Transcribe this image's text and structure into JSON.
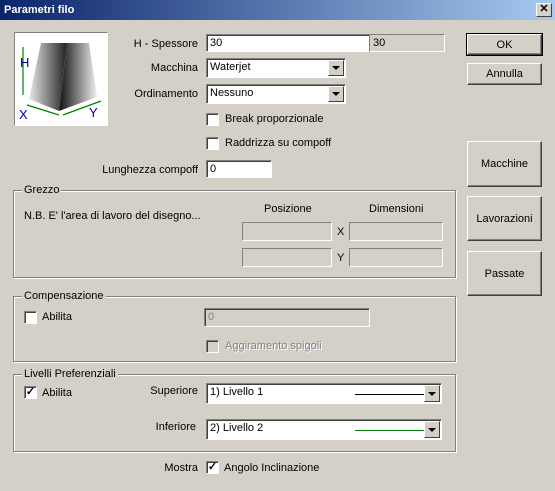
{
  "window": {
    "title": "Parametri filo",
    "close_glyph": "✕"
  },
  "icon": {
    "name": "wire-thickness-icon",
    "h_label": "H",
    "x_label": "X",
    "y_label": "Y"
  },
  "spessore": {
    "label": "H - Spessore",
    "value": "30",
    "readout": "30"
  },
  "macchina": {
    "label": "Macchina",
    "value": "Waterjet"
  },
  "ordinamento": {
    "label": "Ordinamento",
    "value": "Nessuno"
  },
  "break_prop": {
    "label": "Break proporzionale",
    "checked": false
  },
  "raddrizza": {
    "label": "Raddrizza su compoff",
    "checked": false
  },
  "lunghezza": {
    "label": "Lunghezza compoff",
    "value": "0"
  },
  "grezzo": {
    "title": "Grezzo",
    "note": "N.B. E' l'area di lavoro del disegno...",
    "posizione": "Posizione",
    "dimensioni": "Dimensioni",
    "x_label": "X",
    "y_label": "Y"
  },
  "compensazione": {
    "title": "Compensazione",
    "abilita": "Abilita",
    "value": "0",
    "aggiramento": "Aggiramento spigoli"
  },
  "livelli": {
    "title": "Livelli Preferenziali",
    "abilita": "Abilita",
    "superiore_label": "Superiore",
    "superiore_value": "1) Livello 1",
    "superiore_color": "#000000",
    "inferiore_label": "Inferiore",
    "inferiore_value": "2) Livello 2",
    "inferiore_color": "#008000"
  },
  "mostra": {
    "label": "Mostra",
    "check_label": "Angolo Inclinazione",
    "checked": true
  },
  "buttons": {
    "ok": "OK",
    "annulla": "Annulla",
    "macchine": "Macchine",
    "lavorazioni": "Lavorazioni",
    "passate": "Passate"
  },
  "check_glyph": "✓"
}
